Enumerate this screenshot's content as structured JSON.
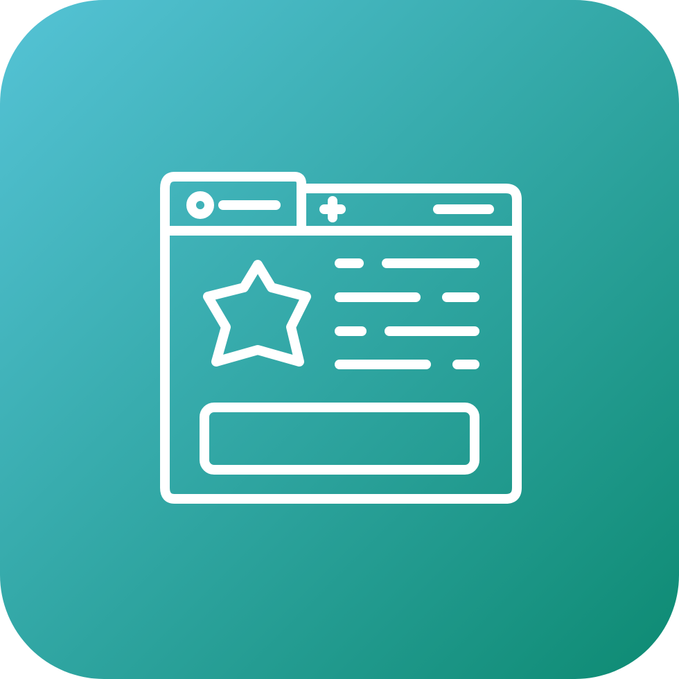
{
  "icon": {
    "name": "browser-window-favorite-icon",
    "description_label": "",
    "colors": {
      "gradient_start": "#55c3d6",
      "gradient_end": "#0d8a72",
      "stroke": "#ffffff"
    }
  }
}
